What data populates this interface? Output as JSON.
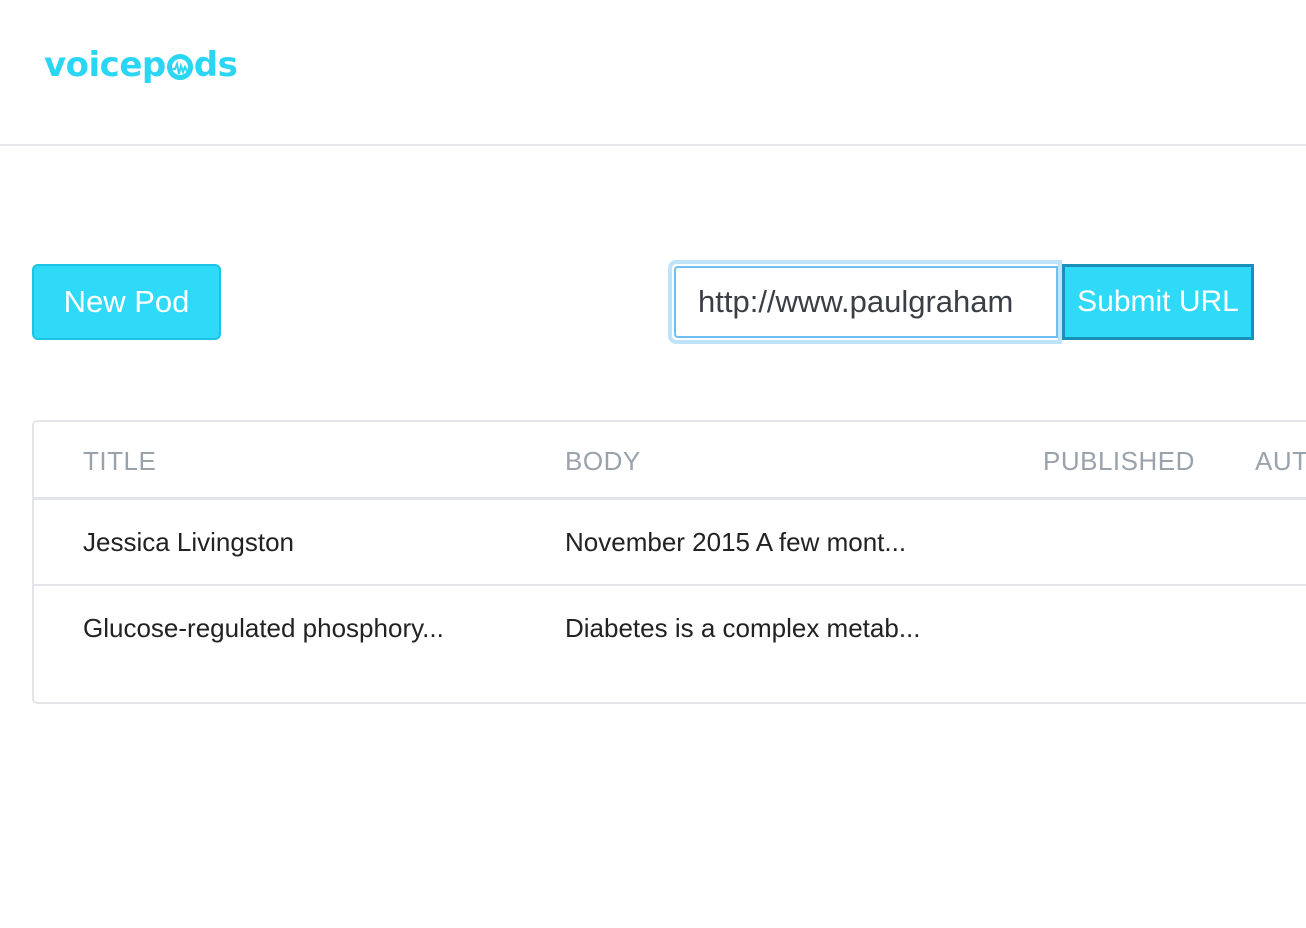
{
  "header": {
    "logo_text_a": "voicep",
    "logo_text_b": "ds",
    "logo_icon": "soundwave-o-icon",
    "brand_color": "#2bd6f5"
  },
  "toolbar": {
    "new_pod_label": "New Pod",
    "url_value": "http://www.paulgraham",
    "submit_label": "Submit URL",
    "accent_color": "#2fdaf8"
  },
  "table": {
    "columns": [
      "TITLE",
      "BODY",
      "PUBLISHED",
      "AUT"
    ],
    "rows": [
      {
        "title": "Jessica Livingston",
        "body": "November 2015 A few mont...",
        "published": "",
        "author": ""
      },
      {
        "title": "Glucose-regulated phosphory...",
        "body": "Diabetes is a complex metab...",
        "published": "",
        "author": ""
      }
    ]
  }
}
